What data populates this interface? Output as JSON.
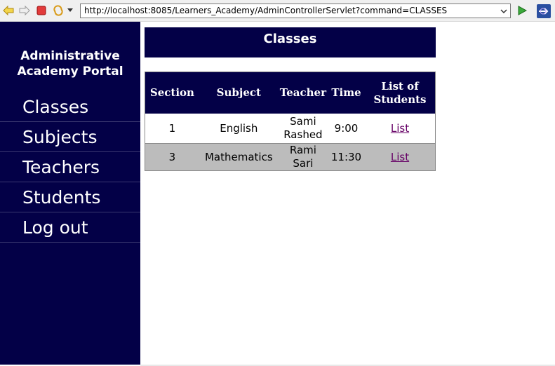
{
  "browser": {
    "url": "http://localhost:8085/Learners_Academy/AdminControllerServlet?command=CLASSES",
    "icons": [
      "back-arrow-icon",
      "forward-arrow-icon",
      "stop-icon",
      "refresh-icon",
      "dropdown-arrow-icon",
      "go-play-icon",
      "browser-logo-icon"
    ]
  },
  "sidebar": {
    "title": "Administrative\nAcademy Portal",
    "items": [
      {
        "label": "Classes"
      },
      {
        "label": "Subjects"
      },
      {
        "label": "Teachers"
      },
      {
        "label": "Students"
      },
      {
        "label": "Log out"
      }
    ]
  },
  "main": {
    "heading": "Classes",
    "table": {
      "headers": [
        "Section",
        "Subject",
        "Teacher",
        "Time",
        "List of Students"
      ],
      "rows": [
        {
          "section": "1",
          "subject": "English",
          "teacher": "Sami Rashed",
          "time": "9:00",
          "link": "List"
        },
        {
          "section": "3",
          "subject": "Mathematics",
          "teacher": "Rami Sari",
          "time": "11:30",
          "link": "List"
        }
      ]
    }
  },
  "colors": {
    "navy": "#030047",
    "row_alt": "#bcbcbc",
    "link_visited": "#660066"
  }
}
